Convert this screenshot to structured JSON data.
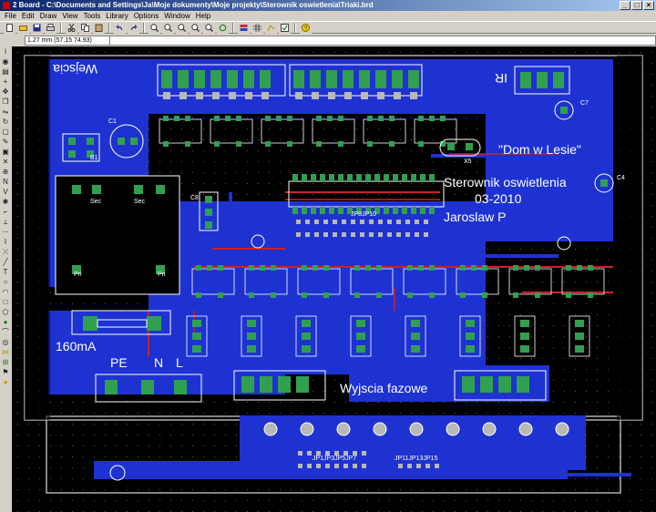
{
  "window": {
    "title": "2 Board - C:\\Documents and Settings\\Ja\\Moje dokumenty\\Moje projekty\\Sterownik oswietlenia\\Triaki.brd",
    "buttons": {
      "minimize": "_",
      "maximize": "□",
      "close": "×"
    }
  },
  "menu": [
    "File",
    "Edit",
    "Draw",
    "View",
    "Tools",
    "Library",
    "Options",
    "Window",
    "Help"
  ],
  "toolbar": {
    "icons": [
      "new-file-icon",
      "open-folder-icon",
      "save-icon",
      "print-icon",
      "cut-icon",
      "copy-icon",
      "paste-icon",
      "undo-icon",
      "redo-icon",
      "zoom-in-icon",
      "zoom-out-icon",
      "zoom-fit-icon",
      "zoom-window-icon",
      "zoom-previous-icon",
      "redraw-icon",
      "layer-icon",
      "grid-icon",
      "ratsnest-icon",
      "drc-icon",
      "help-icon"
    ]
  },
  "coordinate_readout": "1.27 mm (57.15 74.93)",
  "left_tools": [
    "info-icon",
    "show-icon",
    "display-icon",
    "mark-icon",
    "move-icon",
    "copy-icon",
    "mirror-icon",
    "rotate-icon",
    "group-icon",
    "change-icon",
    "paste-icon",
    "delete-icon",
    "add-icon",
    "name-icon",
    "value-icon",
    "smash-icon",
    "miter-icon",
    "split-icon",
    "optimize-icon",
    "route-icon",
    "ripup-icon",
    "wire-icon",
    "text-icon",
    "circle-icon",
    "arc-icon",
    "rect-icon",
    "polygon-icon",
    "via-icon",
    "signal-icon",
    "hole-icon",
    "ratsnest-icon",
    "autorouter-icon",
    "erc-icon",
    "drc-icon"
  ],
  "board": {
    "labels": {
      "wejscia": "Wejscia",
      "ir": "IR",
      "dom": "\"Dom w Lesie\"",
      "sterownik": "Sterownik oswietlenia",
      "date": "03-2010",
      "author": "Jaroslaw P",
      "current": "160mA",
      "pe": "PE",
      "n": "N",
      "l": "L",
      "wyjscia": "Wyjscia fazowe",
      "sec1": "Sec",
      "sec2": "Sec",
      "pri1": "Pri",
      "pri2": "Pri",
      "b1": "B1",
      "c1": "C1",
      "c7": "C7",
      "c4": "C4",
      "c8": "C8",
      "jp": "JP8JP10",
      "jp2": "JP1JP3JP5JP7",
      "jp3": "JP11JP13JP15",
      "x5": "X5"
    },
    "colors": {
      "background": "#000000",
      "top_copper": "#cc2222",
      "bottom_copper": "#1e32d2",
      "pad": "#30a050",
      "silk": "#ffffff",
      "via": "#b8b8b8"
    }
  }
}
